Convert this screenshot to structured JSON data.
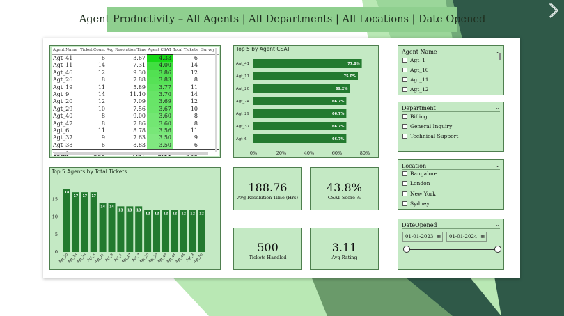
{
  "title": "Agent Productivity – All Agents | All Departments | All Locations | Date Opened",
  "colors": {
    "primary_green": "#237a2f",
    "panel_bg": "#c4e9c4",
    "dark_band": "#2f5948",
    "highlight_green": "#17d917"
  },
  "nav": {
    "icon": "chevron-right-icon"
  },
  "table": {
    "columns": [
      "Agent Name",
      "Ticket Count",
      "Avg Resolution Time",
      "Agent CSAT",
      "Total Tickets",
      "Survey"
    ],
    "rows": [
      {
        "agent": "Agt_41",
        "ticket_count": "6",
        "avg_res": "3.67",
        "csat": "4.33",
        "total": "6"
      },
      {
        "agent": "Agt_11",
        "ticket_count": "14",
        "avg_res": "7.31",
        "csat": "4.00",
        "total": "14"
      },
      {
        "agent": "Agt_46",
        "ticket_count": "12",
        "avg_res": "9.30",
        "csat": "3.86",
        "total": "12"
      },
      {
        "agent": "Agt_26",
        "ticket_count": "8",
        "avg_res": "7.88",
        "csat": "3.83",
        "total": "8"
      },
      {
        "agent": "Agt_19",
        "ticket_count": "11",
        "avg_res": "5.89",
        "csat": "3.77",
        "total": "11"
      },
      {
        "agent": "Agt_9",
        "ticket_count": "14",
        "avg_res": "11.10",
        "csat": "3.70",
        "total": "14"
      },
      {
        "agent": "Agt_20",
        "ticket_count": "12",
        "avg_res": "7.09",
        "csat": "3.69",
        "total": "12"
      },
      {
        "agent": "Agt_29",
        "ticket_count": "10",
        "avg_res": "7.56",
        "csat": "3.67",
        "total": "10"
      },
      {
        "agent": "Agt_40",
        "ticket_count": "8",
        "avg_res": "9.00",
        "csat": "3.60",
        "total": "8"
      },
      {
        "agent": "Agt_47",
        "ticket_count": "8",
        "avg_res": "7.86",
        "csat": "3.60",
        "total": "8"
      },
      {
        "agent": "Agt_6",
        "ticket_count": "11",
        "avg_res": "8.78",
        "csat": "3.56",
        "total": "11"
      },
      {
        "agent": "Agt_37",
        "ticket_count": "9",
        "avg_res": "7.63",
        "csat": "3.50",
        "total": "9"
      },
      {
        "agent": "Agt_38",
        "ticket_count": "6",
        "avg_res": "8.83",
        "csat": "3.50",
        "total": "6"
      }
    ],
    "total": {
      "label": "Total",
      "ticket_count": "500",
      "avg_res": "7.87",
      "csat": "3.11",
      "total": "500"
    }
  },
  "charts": {
    "top5_csat": {
      "title": "Top 5 by Agent CSAT"
    },
    "top5_tickets": {
      "title": "Top 5 Agents by Total Tickets"
    }
  },
  "chart_data": [
    {
      "type": "bar",
      "orientation": "horizontal",
      "title": "Top 5 by Agent CSAT",
      "categories": [
        "Agt_41",
        "Agt_11",
        "Agt_20",
        "Agt_24",
        "Agt_29",
        "Agt_37",
        "Agt_6"
      ],
      "values": [
        77.8,
        75.0,
        69.2,
        66.7,
        66.7,
        66.7,
        66.7
      ],
      "data_labels": [
        "77.8%",
        "75.0%",
        "69.2%",
        "66.7%",
        "66.7%",
        "66.7%",
        "66.7%"
      ],
      "xlim": [
        0,
        80
      ],
      "x_ticks": [
        "0%",
        "20%",
        "40%",
        "60%",
        "80%"
      ],
      "color": "#237a2f"
    },
    {
      "type": "bar",
      "title": "Top 5 Agents by Total Tickets",
      "categories": [
        "Agt_30",
        "Agt_14",
        "Agt_34",
        "Agt_4",
        "Agt_11",
        "Agt_9",
        "Agt_1",
        "Agt_17",
        "Agt_7",
        "Agt_20",
        "Agt_32",
        "Agt_44",
        "Agt_45",
        "Agt_46",
        "Agt_3",
        "Agt_50"
      ],
      "values": [
        18,
        17,
        17,
        17,
        14,
        14,
        13,
        13,
        13,
        12,
        12,
        12,
        12,
        12,
        12,
        12
      ],
      "ylim": [
        0,
        20
      ],
      "y_ticks": [
        "0",
        "5",
        "10",
        "15"
      ],
      "color": "#237a2f"
    }
  ],
  "kpis": {
    "avg_res": {
      "value": "188.76",
      "label": "Avg Resolution Time (Hrs)"
    },
    "csat": {
      "value": "43.8%",
      "label": "CSAT Score %"
    },
    "tickets": {
      "value": "500",
      "label": "Tickets Handled"
    },
    "rating": {
      "value": "3.11",
      "label": "Avg Rating"
    }
  },
  "slicers": {
    "agent": {
      "title": "Agent Name",
      "options": [
        "Agt_1",
        "Agt_10",
        "Agt_11",
        "Agt_12"
      ]
    },
    "department": {
      "title": "Department",
      "options": [
        "Billing",
        "General Inquiry",
        "Technical Support"
      ]
    },
    "location": {
      "title": "Location",
      "options": [
        "Bangalore",
        "London",
        "New York",
        "Sydney"
      ]
    },
    "date": {
      "title": "DateOpened",
      "start": "01-01-2023",
      "end": "01-01-2024",
      "range_fraction": [
        0,
        1
      ]
    }
  }
}
